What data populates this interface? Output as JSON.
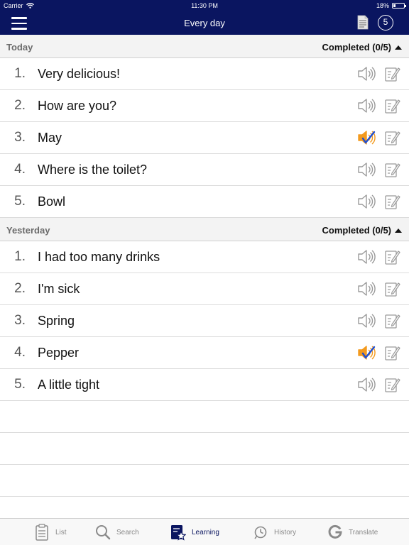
{
  "status_bar": {
    "carrier": "Carrier",
    "time": "11:30 PM",
    "battery": "18%",
    "battery_level": 0.18
  },
  "nav": {
    "title": "Every day",
    "badge_count": "5"
  },
  "sections": [
    {
      "title": "Today",
      "status": "Completed (0/5)",
      "items": [
        {
          "num": "1.",
          "text": "Very delicious!",
          "audio_state": "default"
        },
        {
          "num": "2.",
          "text": "How are you?",
          "audio_state": "default"
        },
        {
          "num": "3.",
          "text": "May",
          "audio_state": "checked"
        },
        {
          "num": "4.",
          "text": "Where is the toilet?",
          "audio_state": "default"
        },
        {
          "num": "5.",
          "text": "Bowl",
          "audio_state": "default"
        }
      ]
    },
    {
      "title": "Yesterday",
      "status": "Completed (0/5)",
      "items": [
        {
          "num": "1.",
          "text": "I had too many drinks",
          "audio_state": "default"
        },
        {
          "num": "2.",
          "text": "I'm sick",
          "audio_state": "default"
        },
        {
          "num": "3.",
          "text": "Spring",
          "audio_state": "default"
        },
        {
          "num": "4.",
          "text": "Pepper",
          "audio_state": "checked"
        },
        {
          "num": "5.",
          "text": "A little tight",
          "audio_state": "default"
        }
      ]
    }
  ],
  "tabs": [
    {
      "label": "List",
      "icon": "clipboard-icon"
    },
    {
      "label": "Search",
      "icon": "search-icon"
    },
    {
      "label": "Learning",
      "icon": "learning-star-icon",
      "active": true
    },
    {
      "label": "History",
      "icon": "history-clock-icon"
    },
    {
      "label": "Translate",
      "icon": "translate-g-icon"
    }
  ],
  "colors": {
    "nav_bg": "#0a1560",
    "accent_orange": "#f39a1e",
    "accent_blue": "#1f4fd1",
    "icon_gray": "#9a9a9a"
  }
}
